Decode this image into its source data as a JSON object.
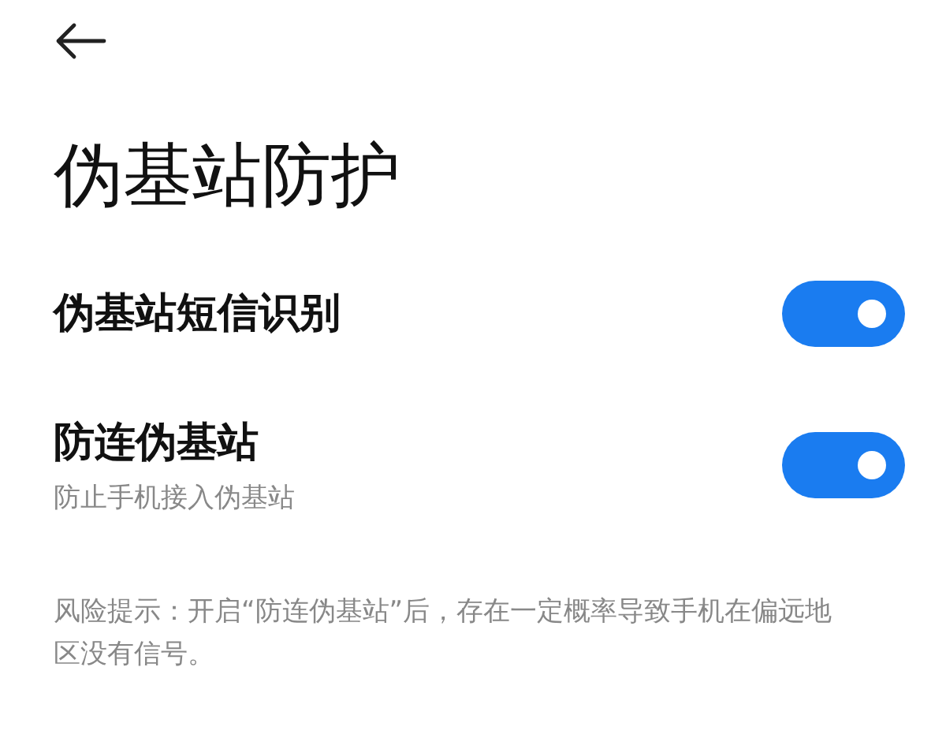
{
  "title": "伪基站防护",
  "settings": [
    {
      "label": "伪基站短信识别",
      "on": true
    },
    {
      "label": "防连伪基站",
      "description": "防止手机接入伪基站",
      "on": true
    }
  ],
  "note": "风险提示：开启“防连伪基站”后，存在一定概率导致手机在偏远地区没有信号。"
}
